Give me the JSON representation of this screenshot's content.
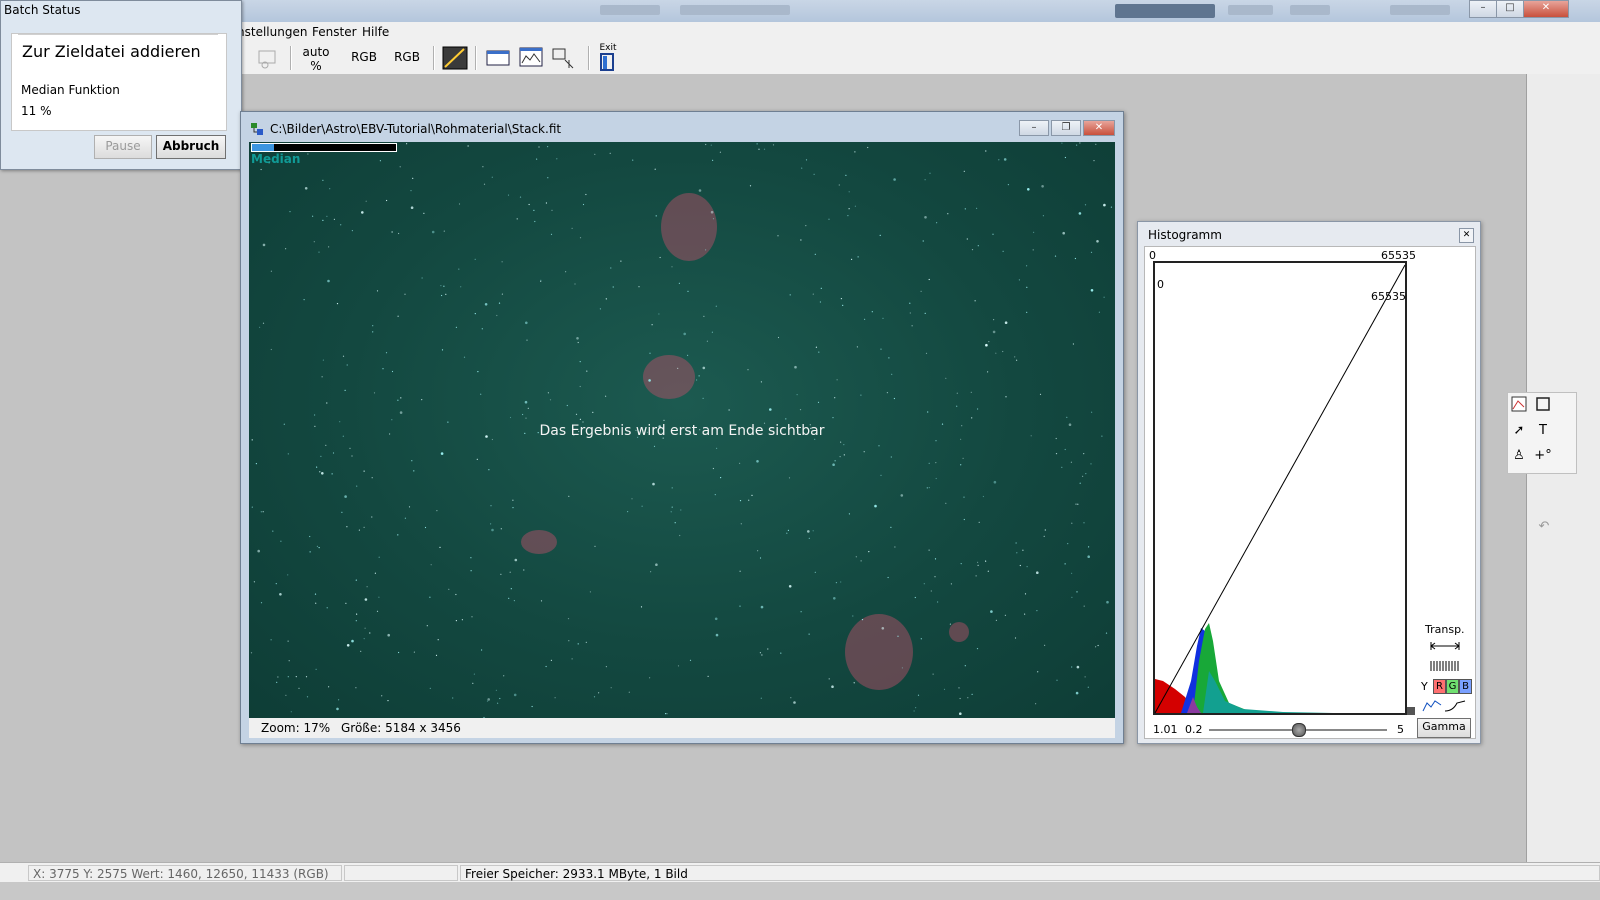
{
  "menu": {
    "items": [
      "nstellungen",
      "Fenster",
      "Hilfe"
    ]
  },
  "toolbar": {
    "auto_label": "auto",
    "auto_sub": "%",
    "rgb1": "RGB",
    "rgb2": "RGB",
    "exit_label": "Exit"
  },
  "batch_dialog": {
    "title": "Batch Status",
    "heading": "Zur Zieldatei addieren",
    "function": "Median Funktion",
    "percent_text": "11 %",
    "pause_label": "Pause",
    "abort_label": "Abbruch"
  },
  "image_window": {
    "title": "C:\\Bilder\\Astro\\EBV-Tutorial\\Rohmaterial\\Stack.fit",
    "progress": 0.15,
    "mode_label": "Median",
    "center_message": "Das Ergebnis wird erst am Ende sichtbar",
    "zoom": "Zoom: 17%",
    "size": "Größe: 5184 x 3456"
  },
  "histogram": {
    "title": "Histogramm",
    "top_left": "0",
    "top_right": "65535",
    "inner_left": "0",
    "inner_right": "65535",
    "gamma_value": "1.01",
    "slider_min": "0.2",
    "slider_max": "5",
    "slider_position": 0.5,
    "transp_label": "Transp.",
    "channels": [
      "Y",
      "R",
      "G",
      "B"
    ],
    "gamma_button": "Gamma",
    "colors": {
      "red": "#d40000",
      "green": "#1aa31a",
      "blue": "#1030e0",
      "teal": "#0fa090"
    }
  },
  "right_tools": [
    "histogram-tool-icon",
    "rectangle-select-icon",
    "pin-icon",
    "text-icon",
    "stamp-icon",
    "marker-icon",
    "undo-icon"
  ],
  "statusbar": {
    "coords": "X: 3775  Y: 2575  Wert: 1460, 12650, 11433 (RGB)",
    "memory": "Freier Speicher: 2933.1 MByte, 1 Bild"
  }
}
